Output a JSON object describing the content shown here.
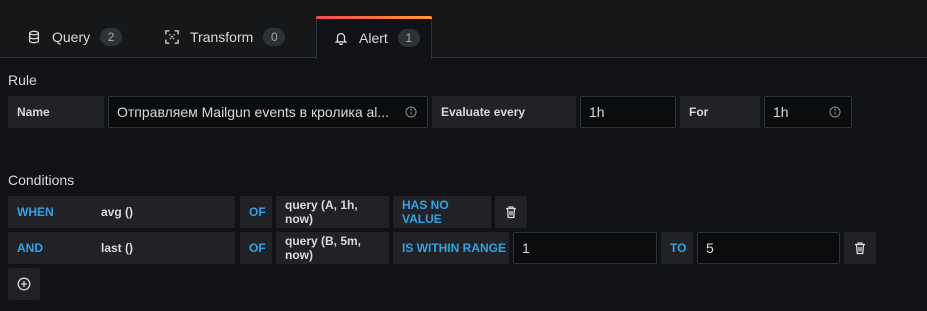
{
  "tabs": [
    {
      "label": "Query",
      "count": "2",
      "icon": "database-icon"
    },
    {
      "label": "Transform",
      "count": "0",
      "icon": "transform-icon"
    },
    {
      "label": "Alert",
      "count": "1",
      "icon": "bell-icon"
    }
  ],
  "active_tab": "Alert",
  "rule": {
    "title": "Rule",
    "name_label": "Name",
    "name_value": "Отправляем Mailgun events в кролика al...",
    "evaluate_label": "Evaluate every",
    "evaluate_value": "1h",
    "for_label": "For",
    "for_value": "1h"
  },
  "conditions": {
    "title": "Conditions",
    "rows": [
      {
        "keyword": "WHEN",
        "reducer": "avg ()",
        "of": "OF",
        "query": "query (A, 1h, now)",
        "evaluator": "HAS NO VALUE"
      },
      {
        "keyword": "AND",
        "reducer": "last ()",
        "of": "OF",
        "query": "query (B, 5m, now)",
        "evaluator": "IS WITHIN RANGE",
        "from": "1",
        "to_label": "TO",
        "to": "5"
      }
    ]
  },
  "colors": {
    "accent_blue": "#33a2e5",
    "tab_gradient_start": "#f2495c",
    "tab_gradient_end": "#ff9830",
    "background": "#111217"
  }
}
